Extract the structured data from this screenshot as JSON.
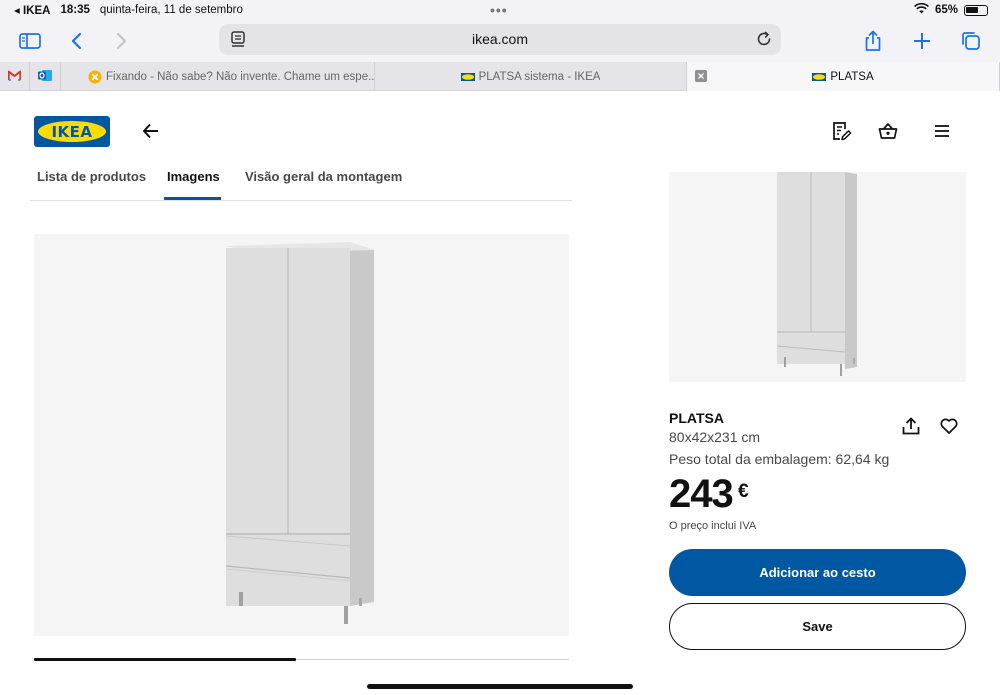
{
  "status_bar": {
    "back_app": "◂ IKEA",
    "time": "18:35",
    "date": "quinta-feira, 11 de setembro",
    "multitask_dots": "•••",
    "battery_percent": "65%",
    "battery_level": 0.65
  },
  "browser": {
    "url": "ikea.com",
    "tabs": [
      {
        "label": "Fixando - Não sabe? Não invente. Chame um espe...",
        "active": false
      },
      {
        "label": "PLATSA sistema - IKEA",
        "active": false
      },
      {
        "label": "PLATSA",
        "active": true
      }
    ]
  },
  "brand": {
    "logo_text": "IKEA"
  },
  "page_tabs": {
    "items": [
      "Lista de produtos",
      "Imagens",
      "Visão geral da montagem"
    ],
    "active_index": 1
  },
  "gallery": {
    "progress": 0.49
  },
  "product": {
    "name": "PLATSA",
    "dimensions": "80x42x231 cm",
    "weight": "Peso total da embalagem: 62,64 kg",
    "price": "243",
    "currency": "€",
    "vat_note": "O preço inclui IVA",
    "add_to_cart_label": "Adicionar ao cesto",
    "save_label": "Save"
  },
  "colors": {
    "ikea_blue": "#0058a3",
    "ikea_yellow": "#ffdb00",
    "text": "#111111",
    "image_bg": "#f5f5f5"
  }
}
